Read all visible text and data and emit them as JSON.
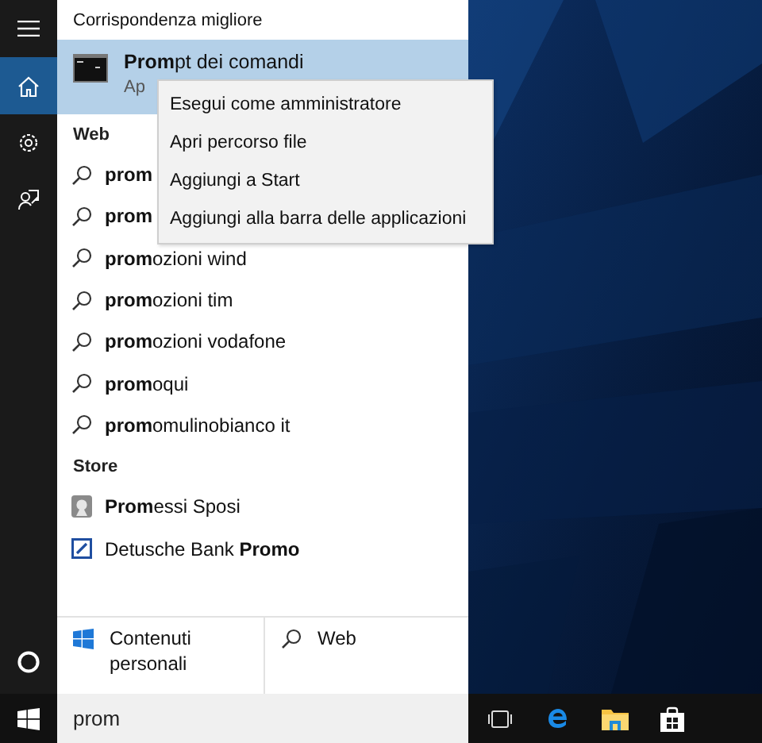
{
  "rail": {
    "items": [
      {
        "kind": "home",
        "selected": true
      },
      {
        "kind": "settings",
        "selected": false
      },
      {
        "kind": "feedback",
        "selected": false
      }
    ]
  },
  "best_match": {
    "heading": "Corrispondenza migliore",
    "title": "**Prom**pt dei comandi",
    "subtitle": "Ap",
    "selected": true
  },
  "context_menu": {
    "items": [
      "Esegui come amministratore",
      "Apri percorso file",
      "Aggiungi a Start",
      "Aggiungi alla barra delle applicazioni"
    ]
  },
  "web": {
    "heading": "Web",
    "results": [
      {
        "match": "prom"
      },
      {
        "match": "prom"
      },
      {
        "match": "prom",
        "rest": "ozioni wind"
      },
      {
        "match": "prom",
        "rest": "ozioni tim"
      },
      {
        "match": "prom",
        "rest": "ozioni vodafone"
      },
      {
        "match": "prom",
        "rest": "oqui"
      },
      {
        "match": "prom",
        "rest": "omulinobianco it"
      }
    ]
  },
  "store": {
    "heading": "Store",
    "results": [
      {
        "kind": "medal",
        "text": "**Prom**essi Sposi"
      },
      {
        "kind": "bank",
        "text": "Detusche Bank **Promo**"
      }
    ]
  },
  "filters": [
    {
      "kind": "windows",
      "label": "Contenuti personali"
    },
    {
      "kind": "search",
      "label": "Web"
    }
  ],
  "search_box": {
    "value": "prom"
  },
  "taskbar": {
    "items": [
      {
        "kind": "taskview"
      },
      {
        "kind": "browser"
      },
      {
        "kind": "folder"
      },
      {
        "kind": "store"
      }
    ]
  }
}
